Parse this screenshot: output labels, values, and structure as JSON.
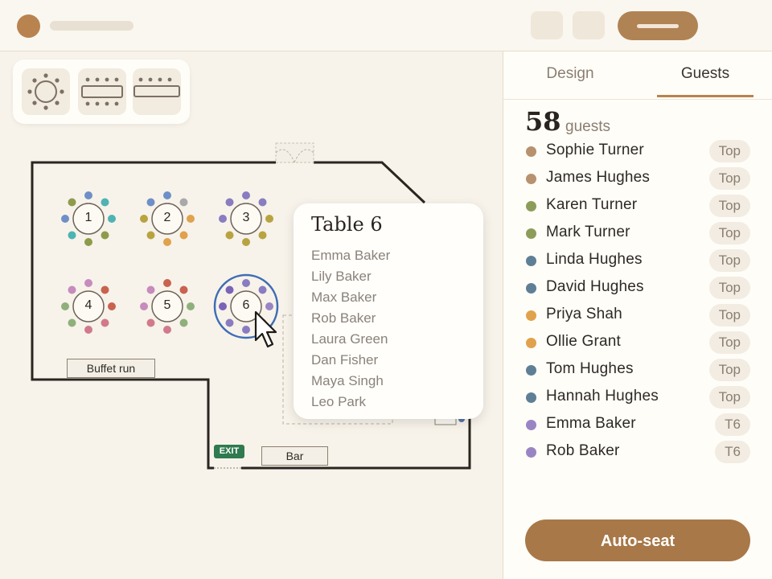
{
  "header": {
    "logo_icon": "circle-logo-icon",
    "action_icons": [
      "toolbar-icon",
      "toolbar-icon"
    ],
    "primary_action_icon": "pill-button-icon"
  },
  "palette": {
    "items": [
      {
        "name": "round-table-icon"
      },
      {
        "name": "banquet-table-icon"
      },
      {
        "name": "long-table-icon"
      }
    ]
  },
  "floorplan": {
    "tables": [
      {
        "number": "1"
      },
      {
        "number": "2"
      },
      {
        "number": "3"
      },
      {
        "number": "4"
      },
      {
        "number": "5"
      },
      {
        "number": "6"
      }
    ],
    "labels": {
      "buffet": "Buffet run",
      "bar": "Bar",
      "exit": "EXIT"
    },
    "selected_table": "6"
  },
  "popover": {
    "title": "Table 6",
    "guests": [
      "Emma Baker",
      "Lily Baker",
      "Max Baker",
      "Rob Baker",
      "Laura Green",
      "Dan Fisher",
      "Maya Singh",
      "Leo Park"
    ]
  },
  "sidebar": {
    "tabs": [
      {
        "label": "Design",
        "active": false
      },
      {
        "label": "Guests",
        "active": true
      }
    ],
    "guest_count": "58",
    "guest_count_label": "guests",
    "guests": [
      {
        "name": "Sophie Turner",
        "badge": "Top",
        "color": "#b8916e"
      },
      {
        "name": "James Hughes",
        "badge": "Top",
        "color": "#b8916e"
      },
      {
        "name": "Karen Turner",
        "badge": "Top",
        "color": "#8c9d5a"
      },
      {
        "name": "Mark Turner",
        "badge": "Top",
        "color": "#8c9d5a"
      },
      {
        "name": "Linda Hughes",
        "badge": "Top",
        "color": "#5f7f96"
      },
      {
        "name": "David Hughes",
        "badge": "Top",
        "color": "#5f7f96"
      },
      {
        "name": "Priya Shah",
        "badge": "Top",
        "color": "#e0a24c"
      },
      {
        "name": "Ollie Grant",
        "badge": "Top",
        "color": "#e0a24c"
      },
      {
        "name": "Tom Hughes",
        "badge": "Top",
        "color": "#5f7f96"
      },
      {
        "name": "Hannah Hughes",
        "badge": "Top",
        "color": "#5f7f96"
      },
      {
        "name": "Emma Baker",
        "badge": "T6",
        "color": "#9a85c4"
      },
      {
        "name": "Rob Baker",
        "badge": "T6",
        "color": "#9a85c4"
      }
    ],
    "auto_seat_label": "Auto-seat"
  },
  "colors": {
    "accent": "#b8834f",
    "selection": "#3f6db5",
    "exit": "#2f7a4e"
  }
}
